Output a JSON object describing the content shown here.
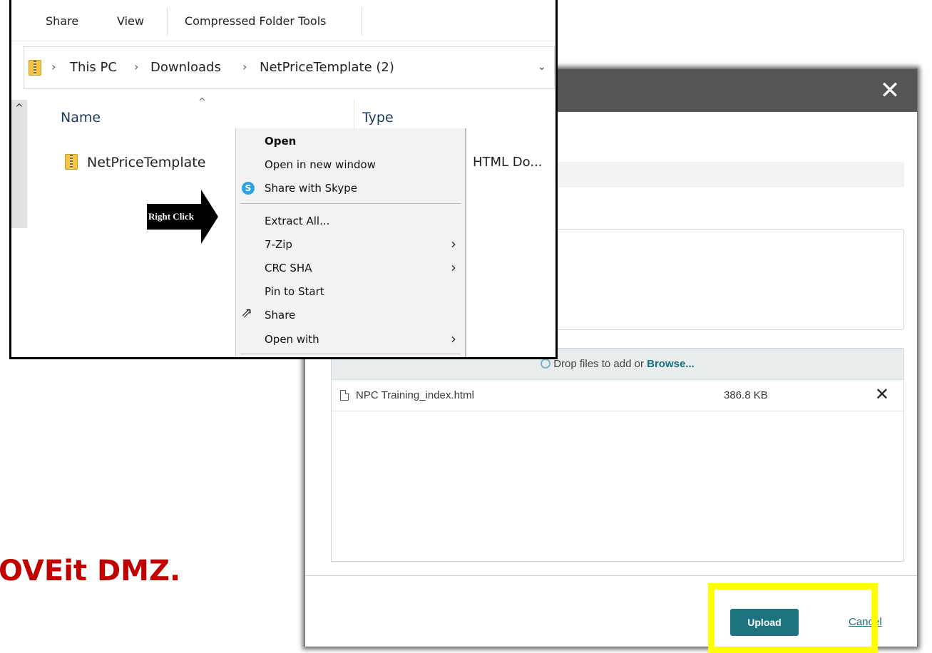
{
  "caption": {
    "text": "OVEit DMZ."
  },
  "explorer": {
    "ribbon_tabs": [
      "Share",
      "View",
      "Compressed Folder Tools"
    ],
    "breadcrumb": [
      "This PC",
      "Downloads",
      "NetPriceTemplate (2)"
    ],
    "columns": {
      "name": "Name",
      "type": "Type"
    },
    "file": {
      "name": "NetPriceTemplate",
      "type": "HTML Do..."
    },
    "callout": "Right Click"
  },
  "context_menu": {
    "items": [
      {
        "label": "Open",
        "bold": true
      },
      {
        "label": "Open in new window"
      },
      {
        "label": "Share with Skype",
        "icon": "skype-icon"
      },
      {
        "label": "Extract All..."
      },
      {
        "label": "7-Zip",
        "submenu": true
      },
      {
        "label": "CRC SHA",
        "submenu": true
      },
      {
        "label": "Pin to Start"
      },
      {
        "label": "Share",
        "icon": "share-icon"
      },
      {
        "label": "Open with",
        "submenu": true
      }
    ]
  },
  "dialog": {
    "close": "✕",
    "dropzone": {
      "prefix": "Drop files to add or ",
      "browse": "Browse..."
    },
    "file": {
      "name": "NPC Training_index.html",
      "size": "386.8 KB",
      "remove": "✕"
    },
    "upload_label": "Upload",
    "cancel_label": "Cancel"
  },
  "colors": {
    "caption": "#c00000",
    "dialog_header": "#555555",
    "upload_button": "#1d7480",
    "highlight": "#ffff00"
  }
}
